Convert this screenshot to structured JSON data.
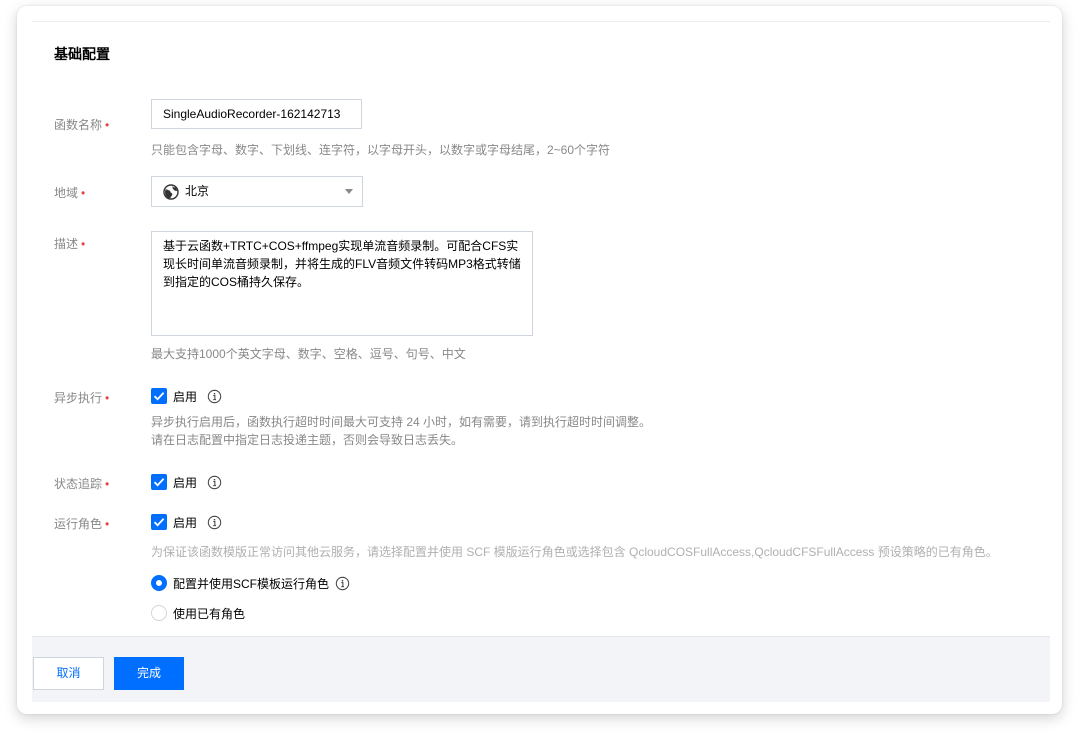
{
  "section": {
    "title": "基础配置"
  },
  "function_name": {
    "label": "函数名称",
    "required_mark": "•",
    "value": "SingleAudioRecorder-162142713",
    "hint": "只能包含字母、数字、下划线、连字符，以字母开头，以数字或字母结尾，2~60个字符"
  },
  "region": {
    "label": "地域",
    "required_mark": "•",
    "value": "北京",
    "icon": "globe-icon"
  },
  "description": {
    "label": "描述",
    "required_mark": "•",
    "value": "基于云函数+TRTC+COS+ffmpeg实现单流音频录制。可配合CFS实现长时间单流音频录制，并将生成的FLV音频文件转码MP3格式转储到指定的COS桶持久保存。",
    "hint": "最大支持1000个英文字母、数字、空格、逗号、句号、中文"
  },
  "async_exec": {
    "label": "异步执行",
    "required_mark": "•",
    "checkbox_label": "启用",
    "checked": true,
    "hint_line1": "异步执行启用后，函数执行超时时间最大可支持 24 小时，如有需要，请到执行超时时间调整。",
    "hint_line2": "请在日志配置中指定日志投递主题，否则会导致日志丢失。"
  },
  "status_tracking": {
    "label": "状态追踪",
    "required_mark": "•",
    "checkbox_label": "启用",
    "checked": true
  },
  "run_role": {
    "label": "运行角色",
    "required_mark": "•",
    "checkbox_label": "启用",
    "checked": true,
    "hint": "为保证该函数模版正常访问其他云服务，请选择配置并使用 SCF 模版运行角色或选择包含 QcloudCOSFullAccess,QcloudCFSFullAccess 预设策略的已有角色。",
    "options": [
      {
        "label": "配置并使用SCF模板运行角色",
        "selected": true
      },
      {
        "label": "使用已有角色",
        "selected": false
      }
    ]
  },
  "footer": {
    "cancel_label": "取消",
    "done_label": "完成"
  },
  "colors": {
    "primary": "#006eff",
    "required": "#e54545",
    "hint": "#888888",
    "border": "#cfd5de",
    "footer_bg": "#f2f4f8"
  }
}
